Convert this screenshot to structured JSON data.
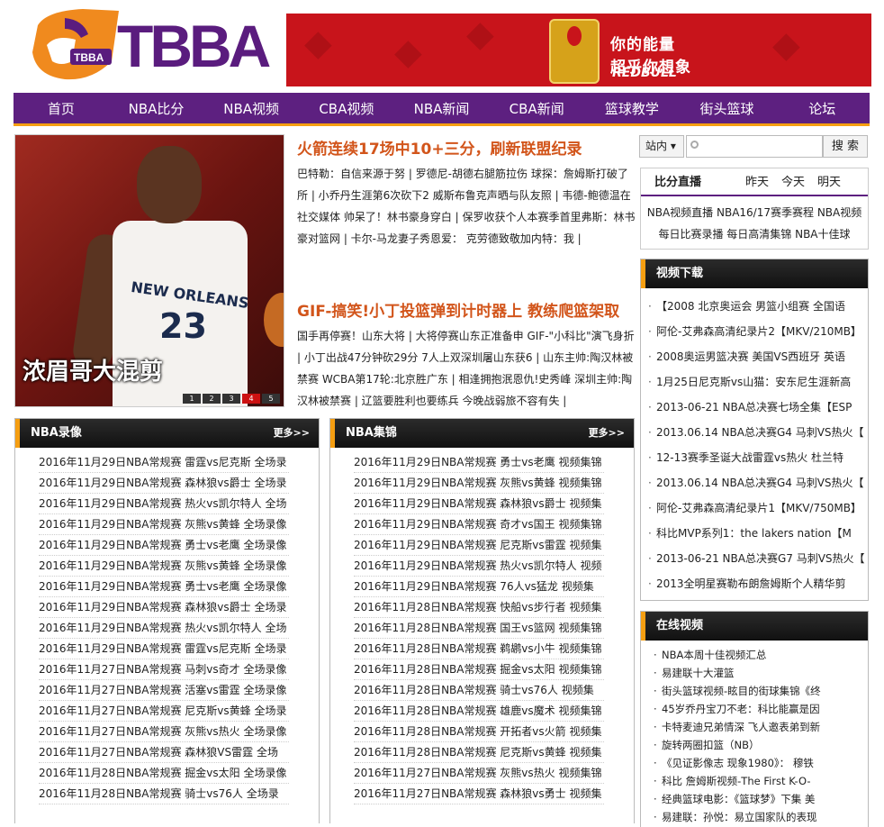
{
  "logo": {
    "text": "TBBA",
    "badge": "TBBA"
  },
  "banner": {
    "line1": "你的能量",
    "line2": "超乎你想象",
    "brand": "REDBULL",
    "can_label": "Red Bull 红牛"
  },
  "nav": [
    "首页",
    "NBA比分",
    "NBA视频",
    "CBA视频",
    "NBA新闻",
    "CBA新闻",
    "篮球教学",
    "街头篮球",
    "论坛"
  ],
  "hero": {
    "caption": "浓眉哥大混剪",
    "jersey_text": "NEW ORLEANS",
    "jersey_number": "23",
    "pages": [
      "1",
      "2",
      "3",
      "4",
      "5"
    ],
    "active_page": "4"
  },
  "news": [
    {
      "headline": "火箭连续17场中10+三分，刷新联盟纪录",
      "body": "巴特勒：自信来源于努 | 罗德尼-胡德右腿筋拉伤 球探：詹姆斯打破了所 | 小乔丹生涯第6次砍下2 威斯布鲁克声晒与队友照 | 韦德-鲍德温在社交媒体 帅呆了！林书豪身穿白 | 保罗收获个人本赛季首里弗斯：林书豪对篮网 | 卡尔-马龙妻子秀恩爱： 克劳德致敬加内特：我 |"
    },
    {
      "headline": "GIF-搞笑!小丁投篮弹到计时器上 教练爬篮架取",
      "body": "国手再停赛！山东大将 | 大将停赛山东正准备申 GIF-\"小科比\"演飞身折 | 小丁出战47分钟砍29分 7人上双深圳屠山东获6 | 山东主帅:陶汉林被禁赛 WCBA第17轮:北京胜广东 | 相逢拥抱泯恩仇!史秀峰 深圳主帅:陶汉林被禁赛 | 辽篮要胜利也要练兵 今晚战弱旅不容有失 |"
    }
  ],
  "search": {
    "scope": "站内",
    "placeholder": "",
    "button": "搜 索"
  },
  "live": {
    "title": "比分直播",
    "tabs": [
      "昨天",
      "今天",
      "明天"
    ],
    "links": "NBA视频直播 NBA16/17赛季赛程 NBA视频每日比赛录播 每日高清集锦 NBA十佳球"
  },
  "video_download": {
    "title": "视频下载",
    "items": [
      "【2008 北京奥运会 男篮小组赛 全国语",
      "阿伦-艾弗森高清纪录片2【MKV/210MB】",
      "2008奥运男篮决赛 美国VS西班牙 英语",
      "1月25日尼克斯vs山猫：安东尼生涯新高",
      "2013-06-21 NBA总决赛七场全集【ESP",
      "2013.06.14 NBA总决赛G4 马刺VS热火【",
      "12-13赛季圣诞大战雷霆vs热火 杜兰特",
      "2013.06.14 NBA总决赛G4 马刺VS热火【",
      "阿伦-艾弗森高清纪录片1【MKV/750MB】",
      "科比MVP系列1：the lakers nation【M",
      "2013-06-21 NBA总决赛G7 马刺VS热火【",
      "2013全明星赛勒布朗詹姆斯个人精华剪"
    ]
  },
  "online_video": {
    "title": "在线视频",
    "items": [
      "NBA本周十佳视频汇总",
      "易建联十大灌篮",
      "街头篮球视频-眩目的街球集锦《终",
      "45岁乔丹宝刀不老：科比能赢是因",
      "卡特麦迪兄弟情深 飞人邀表弟到新",
      "旋转两圈扣篮（NB）",
      "《见证影像志 现象1980》： 穆铁",
      "科比 詹姆斯视频-The First K-O-",
      "经典篮球电影：《篮球梦》下集 美",
      "易建联：孙悦：易立国家队的表现"
    ]
  },
  "nba_recordings": {
    "title": "NBA录像",
    "more": "更多>>",
    "items": [
      "2016年11月29日NBA常规赛 雷霆vs尼克斯 全场录",
      "2016年11月29日NBA常规赛 森林狼vs爵士 全场录",
      "2016年11月29日NBA常规赛 热火vs凯尔特人 全场",
      "2016年11月29日NBA常规赛 灰熊vs黄蜂 全场录像",
      "2016年11月29日NBA常规赛 勇士vs老鹰 全场录像",
      "2016年11月29日NBA常规赛 灰熊vs黄蜂 全场录像",
      "2016年11月29日NBA常规赛 勇士vs老鹰 全场录像",
      "2016年11月29日NBA常规赛 森林狼vs爵士 全场录",
      "2016年11月29日NBA常规赛 热火vs凯尔特人 全场",
      "2016年11月29日NBA常规赛 雷霆vs尼克斯 全场录",
      "2016年11月27日NBA常规赛 马刺vs奇才 全场录像",
      "2016年11月27日NBA常规赛 活塞vs雷霆 全场录像",
      "2016年11月27日NBA常规赛 尼克斯vs黄蜂 全场录",
      "2016年11月27日NBA常规赛 灰熊vs热火 全场录像",
      "2016年11月27日NBA常规赛 森林狼VS雷霆 全场",
      "2016年11月28日NBA常规赛 掘金vs太阳 全场录像",
      "2016年11月28日NBA常规赛 骑士vs76人 全场录"
    ]
  },
  "nba_highlights": {
    "title": "NBA集锦",
    "more": "更多>>",
    "items": [
      "2016年11月29日NBA常规赛 勇士vs老鹰 视频集锦",
      "2016年11月29日NBA常规赛 灰熊vs黄蜂 视频集锦",
      "2016年11月29日NBA常规赛 森林狼vs爵士 视频集",
      "2016年11月29日NBA常规赛 奇才vs国王 视频集锦",
      "2016年11月29日NBA常规赛 尼克斯vs雷霆 视频集",
      "2016年11月29日NBA常规赛 热火vs凯尔特人 视频",
      "2016年11月29日NBA常规赛 76人vs猛龙 视频集",
      "2016年11月28日NBA常规赛 快船vs步行者 视频集",
      "2016年11月28日NBA常规赛 国王vs篮网 视频集锦",
      "2016年11月28日NBA常规赛 鹈鹕vs小牛 视频集锦",
      "2016年11月28日NBA常规赛 掘金vs太阳 视频集锦",
      "2016年11月28日NBA常规赛 骑士vs76人 视频集",
      "2016年11月28日NBA常规赛 雄鹿vs魔术 视频集锦",
      "2016年11月28日NBA常规赛 开拓者vs火箭 视频集",
      "2016年11月28日NBA常规赛 尼克斯vs黄蜂 视频集",
      "2016年11月27日NBA常规赛 灰熊vs热火 视频集锦",
      "2016年11月27日NBA常规赛 森林狼vs勇士 视频集"
    ]
  },
  "colors": {
    "brand_purple": "#5d2080",
    "accent_orange": "#f59e11",
    "headline_orange": "#d2551b",
    "banner_red": "#c8141b"
  }
}
